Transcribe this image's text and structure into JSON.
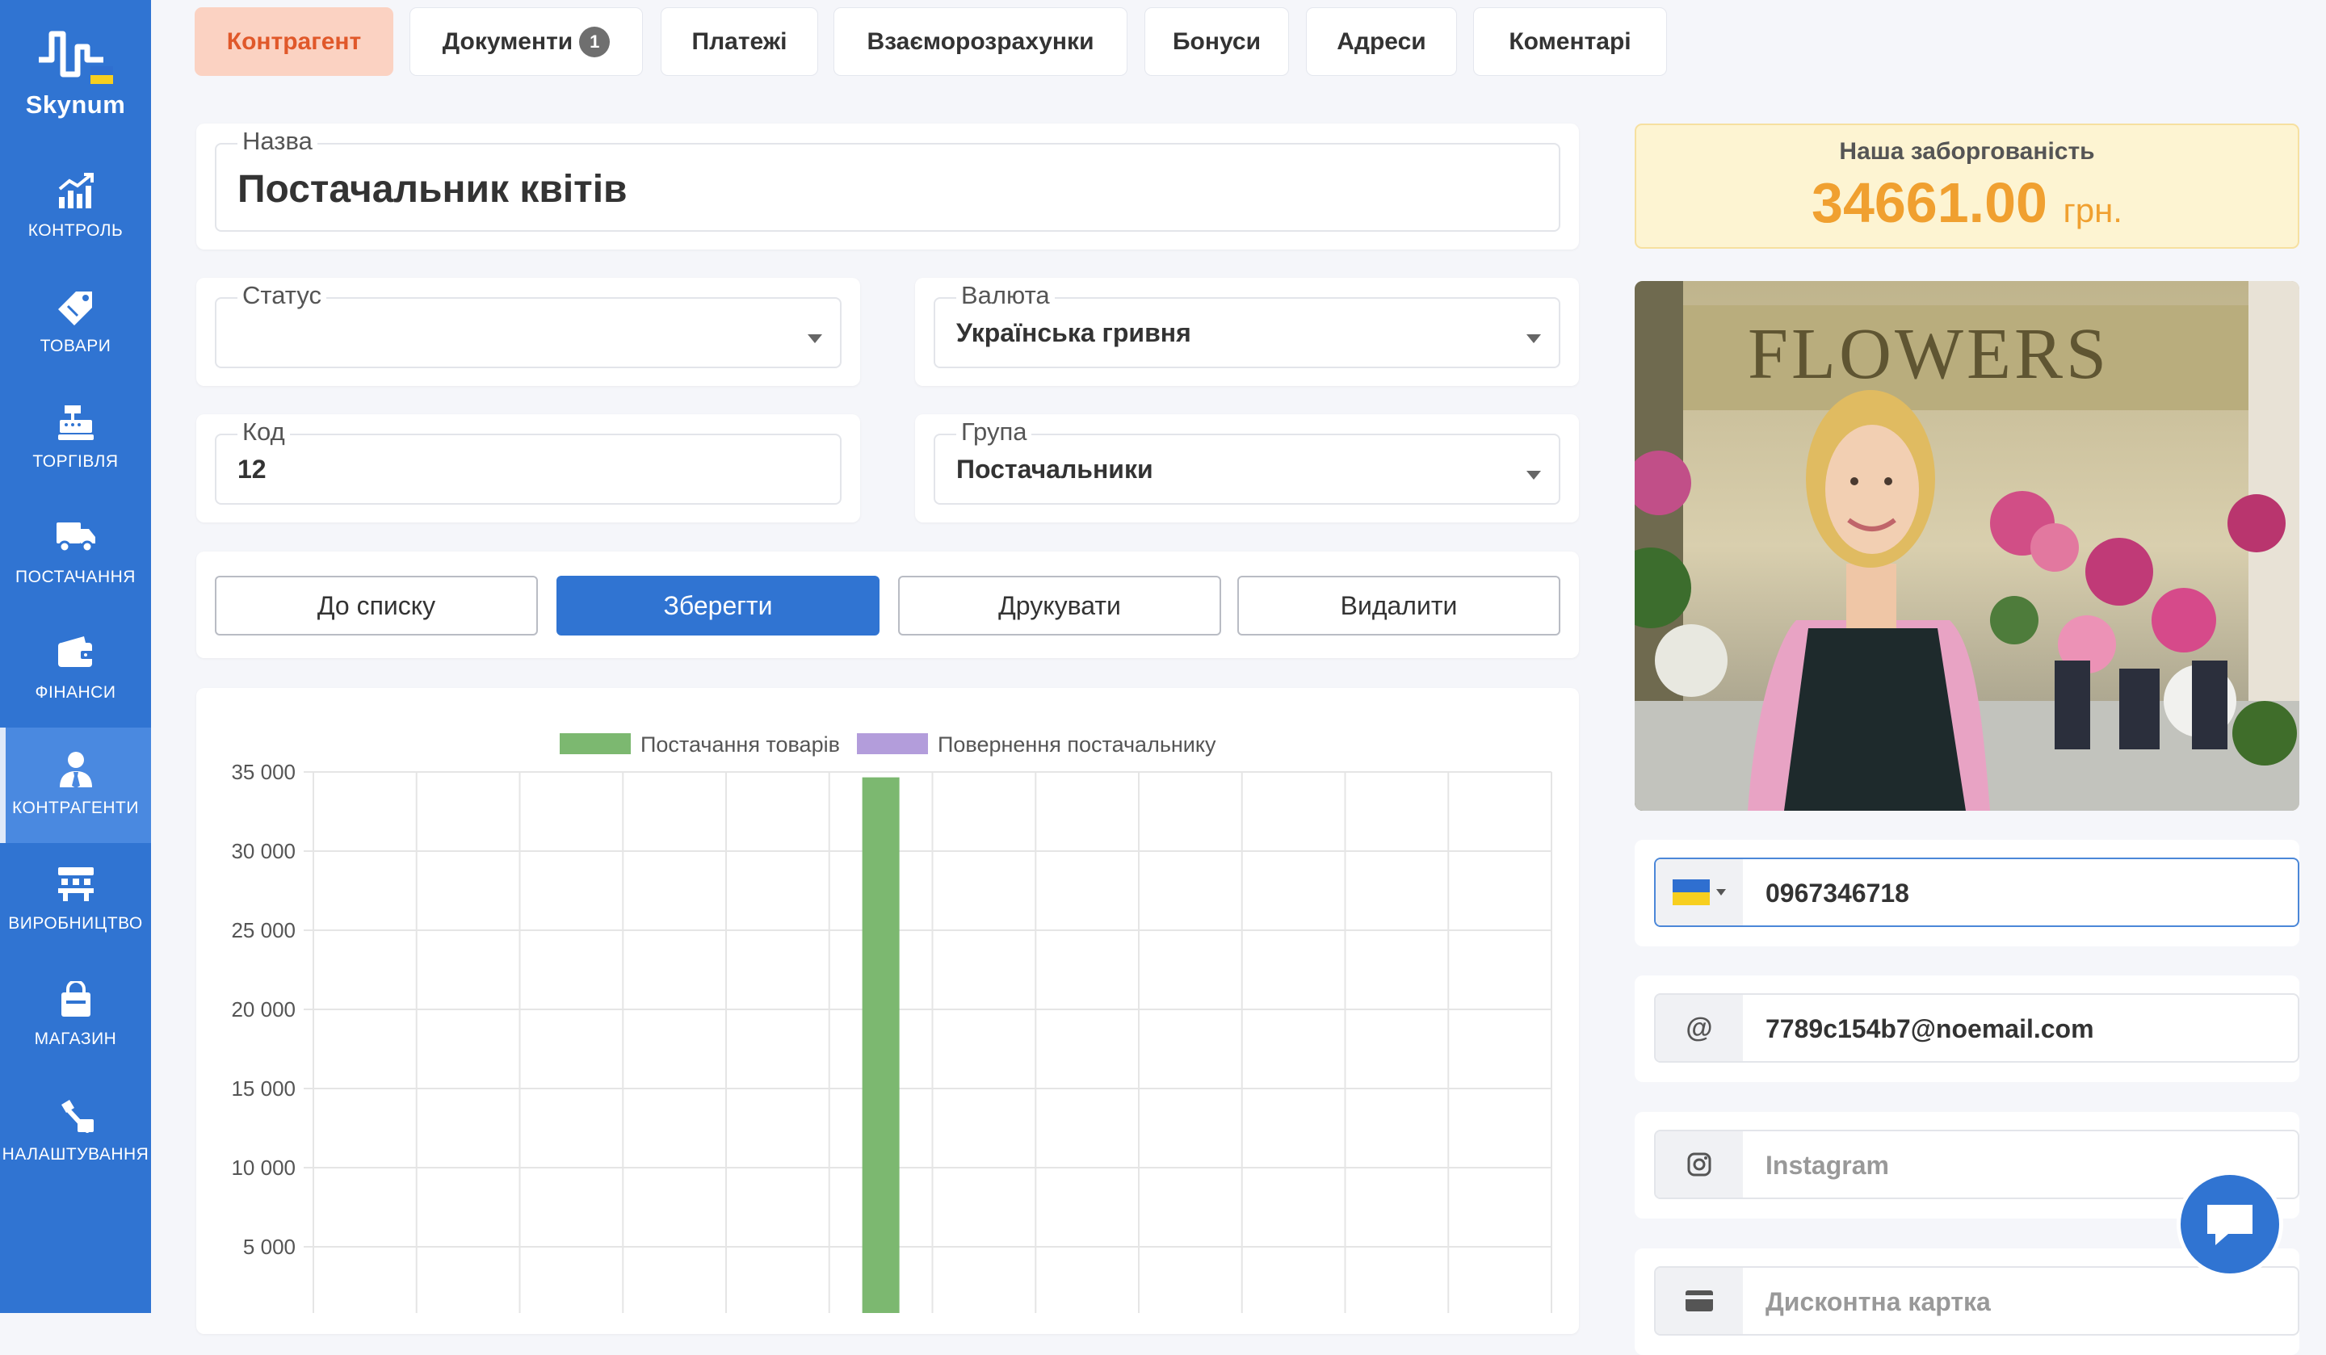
{
  "app": {
    "logo_text": "Skynum"
  },
  "sidebar": {
    "items": [
      {
        "label": "КОНТРОЛЬ",
        "icon": "chart-up-icon"
      },
      {
        "label": "ТОВАРИ",
        "icon": "tags-icon"
      },
      {
        "label": "ТОРГІВЛЯ",
        "icon": "cash-register-icon"
      },
      {
        "label": "ПОСТАЧАННЯ",
        "icon": "truck-icon"
      },
      {
        "label": "ФІНАНСИ",
        "icon": "wallet-icon"
      },
      {
        "label": "КОНТРАГЕНТИ",
        "icon": "user-tie-icon",
        "active": true
      },
      {
        "label": "ВИРОБНИЦТВО",
        "icon": "factory-icon"
      },
      {
        "label": "МАГАЗИН",
        "icon": "shop-bag-icon"
      },
      {
        "label": "НАЛАШТУВАННЯ",
        "icon": "tools-icon"
      }
    ]
  },
  "tabs": [
    {
      "label": "Контрагент",
      "active": true
    },
    {
      "label": "Документи",
      "badge": "1"
    },
    {
      "label": "Платежі"
    },
    {
      "label": "Взаєморозрахунки"
    },
    {
      "label": "Бонуси"
    },
    {
      "label": "Адреси"
    },
    {
      "label": "Коментарі"
    }
  ],
  "form": {
    "name": {
      "label": "Назва",
      "value": "Постачальник квітів"
    },
    "status": {
      "label": "Статус",
      "value": ""
    },
    "currency": {
      "label": "Валюта",
      "value": "Українська гривня"
    },
    "code": {
      "label": "Код",
      "value": "12"
    },
    "group": {
      "label": "Група",
      "value": "Постачальники"
    }
  },
  "actions": {
    "back": "До списку",
    "save": "Зберегти",
    "print": "Друкувати",
    "delete": "Видалити"
  },
  "debt": {
    "title": "Наша заборгованість",
    "amount": "34661.00",
    "currency": "грн."
  },
  "contacts": {
    "phone": "0967346718",
    "email_symbol": "@",
    "email": "7789c154b7@noemail.com",
    "instagram_placeholder": "Instagram",
    "discount_placeholder": "Дисконтна картка"
  },
  "colors": {
    "primary": "#3074d2",
    "accent": "#e0582a",
    "debt_amount": "#f0a030",
    "series_supply": "#7cb870",
    "series_return": "#b39ddb"
  },
  "chart_data": {
    "type": "bar",
    "legend": [
      "Постачання товарів",
      "Повернення постачальнику"
    ],
    "legend_position": "top",
    "y_ticks": [
      "35 000",
      "30 000",
      "25 000",
      "20 000",
      "15 000",
      "10 000",
      "5 000"
    ],
    "ylim": [
      0,
      35000
    ],
    "grid": true,
    "series": [
      {
        "name": "Постачання товарів",
        "values": [
          0,
          0,
          0,
          0,
          0,
          34661,
          0,
          0,
          0,
          0,
          0,
          0
        ]
      },
      {
        "name": "Повернення постачальнику",
        "values": [
          0,
          0,
          0,
          0,
          0,
          0,
          0,
          0,
          0,
          0,
          0,
          0
        ]
      }
    ]
  }
}
